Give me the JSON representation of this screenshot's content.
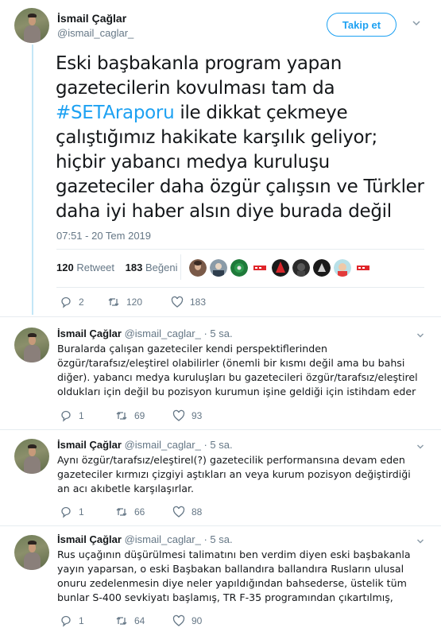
{
  "main_tweet": {
    "author_name": "İsmail Çağlar",
    "author_handle": "@ismail_caglar_",
    "follow_label": "Takip et",
    "text_before": "Eski başbakanla program yapan gazetecilerin kovulması tam da ",
    "hashtag": "#SETAraporu",
    "text_after": " ile dikkat çekmeye çalıştığımız hakikate karşılık geliyor; hiçbir yabancı medya kuruluşu gazeteciler daha özgür çalışsın ve Türkler daha iyi haber alsın diye burada değil",
    "timestamp": "07:51 - 20 Tem 2019",
    "retweet_count": "120",
    "retweet_label": "Retweet",
    "like_count": "183",
    "like_label": "Beğeni",
    "actions": {
      "replies": "2",
      "retweets": "120",
      "likes": "183"
    }
  },
  "replies": [
    {
      "name": "İsmail Çağlar",
      "handle": "@ismail_caglar_",
      "time": "· 5 sa.",
      "text": "Buralarda çalışan gazeteciler kendi perspektiflerinden özgür/tarafsız/eleştirel olabilirler (önemli bir kısmı değil ama bu bahsi diğer). yabancı medya kuruluşları bu gazetecileri özgür/tarafsız/eleştirel oldukları için değil bu pozisyon kurumun işine geldiği için istihdam eder",
      "replies": "1",
      "retweets": "69",
      "likes": "93"
    },
    {
      "name": "İsmail Çağlar",
      "handle": "@ismail_caglar_",
      "time": "· 5 sa.",
      "text": "Aynı özgür/tarafsız/eleştirel(?) gazetecilik performansına devam eden gazeteciler kırmızı çizgiyi aştıkları an veya kurum pozisyon değiştirdiği an acı akıbetle karşılaşırlar.",
      "replies": "1",
      "retweets": "66",
      "likes": "88"
    },
    {
      "name": "İsmail Çağlar",
      "handle": "@ismail_caglar_",
      "time": "· 5 sa.",
      "text": "Rus uçağının düşürülmesi talimatını ben verdim diyen eski başbakanla yayın yaparsan, o eski Başbakan ballandıra ballandıra Rusların ulusal onuru zedelenmesin diye neler yapıldığından bahsederse, üstelik tüm bunlar S-400 sevkiyatı başlamış, TR F-35 programından çıkartılmış,",
      "replies": "1",
      "retweets": "64",
      "likes": "90"
    }
  ],
  "colors": {
    "accent": "#1da1f2",
    "muted": "#657786",
    "thread_line": "#c4e6f7",
    "text": "#14171a"
  },
  "icons": {
    "reply": "reply-icon",
    "retweet": "retweet-icon",
    "like": "heart-icon",
    "more": "chevron-down-icon"
  }
}
